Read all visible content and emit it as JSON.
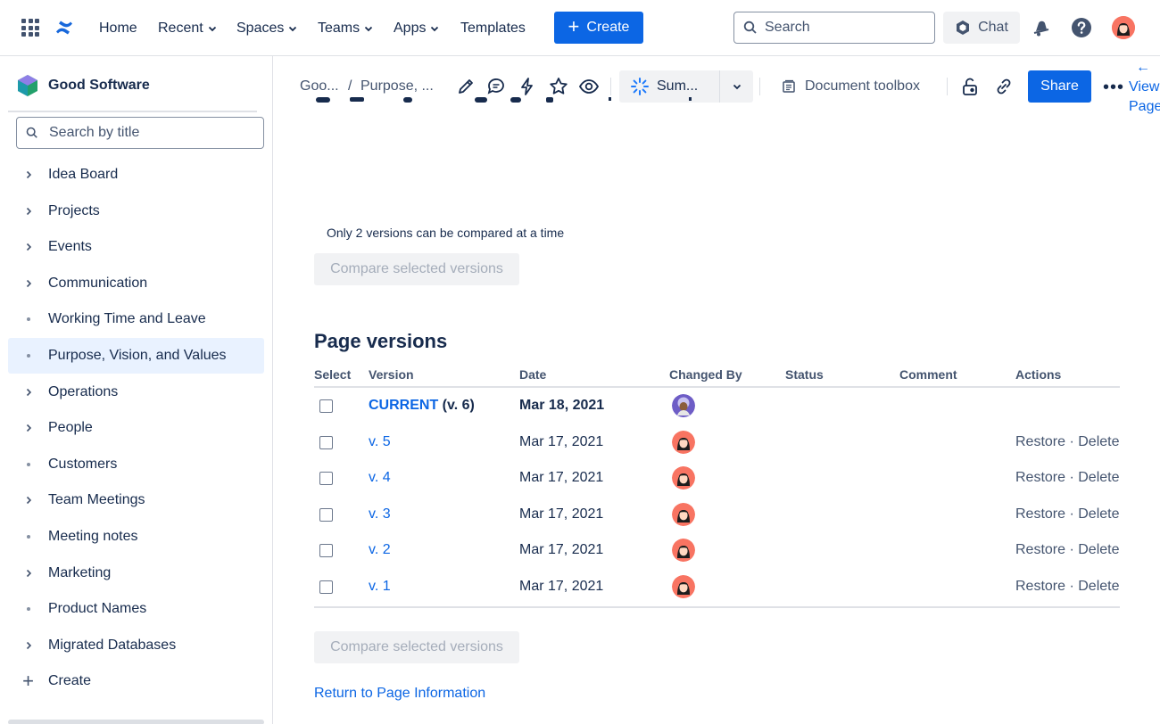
{
  "topnav": {
    "items": [
      {
        "label": "Home",
        "dropdown": false
      },
      {
        "label": "Recent",
        "dropdown": true
      },
      {
        "label": "Spaces",
        "dropdown": true
      },
      {
        "label": "Teams",
        "dropdown": true
      },
      {
        "label": "Apps",
        "dropdown": true
      },
      {
        "label": "Templates",
        "dropdown": false
      }
    ],
    "create_label": "Create",
    "search_placeholder": "Search",
    "chat_label": "Chat"
  },
  "sidebar": {
    "space_name": "Good Software",
    "search_placeholder": "Search by title",
    "items": [
      {
        "label": "Idea Board",
        "type": "chevron"
      },
      {
        "label": "Projects",
        "type": "chevron"
      },
      {
        "label": "Events",
        "type": "chevron"
      },
      {
        "label": "Communication",
        "type": "chevron"
      },
      {
        "label": "Working Time and Leave",
        "type": "dot"
      },
      {
        "label": "Purpose, Vision, and Values",
        "type": "dot",
        "active": true
      },
      {
        "label": "Operations",
        "type": "chevron"
      },
      {
        "label": "People",
        "type": "chevron"
      },
      {
        "label": "Customers",
        "type": "dot"
      },
      {
        "label": "Team Meetings",
        "type": "chevron"
      },
      {
        "label": "Meeting notes",
        "type": "dot"
      },
      {
        "label": "Marketing",
        "type": "chevron"
      },
      {
        "label": "Product Names",
        "type": "dot"
      },
      {
        "label": "Migrated Databases",
        "type": "chevron"
      }
    ],
    "create_label": "Create"
  },
  "toolbar": {
    "breadcrumb_1": "Goo...",
    "breadcrumb_sep": "/",
    "breadcrumb_2": "Purpose, ...",
    "summarize_label": "Sum...",
    "document_toolbox_label": "Document toolbox",
    "share_label": "Share",
    "view_page_arrow": "←",
    "view_page_label": "View Page"
  },
  "content": {
    "notice": "Only 2 versions can be compared at a time",
    "compare_label": "Compare selected versions",
    "section_title": "Page versions",
    "columns": [
      "Select",
      "Version",
      "Date",
      "Changed By",
      "Status",
      "Comment",
      "Actions"
    ],
    "rows": [
      {
        "version_link": "CURRENT",
        "version_suffix": "(v. 6)",
        "date": "Mar 18, 2021",
        "actions": "",
        "current": true
      },
      {
        "version_link": "v. 5",
        "version_suffix": "",
        "date": "Mar 17, 2021",
        "actions": "Restore · Delete"
      },
      {
        "version_link": "v. 4",
        "version_suffix": "",
        "date": "Mar 17, 2021",
        "actions": "Restore · Delete"
      },
      {
        "version_link": "v. 3",
        "version_suffix": "",
        "date": "Mar 17, 2021",
        "actions": "Restore · Delete"
      },
      {
        "version_link": "v. 2",
        "version_suffix": "",
        "date": "Mar 17, 2021",
        "actions": "Restore · Delete"
      },
      {
        "version_link": "v. 1",
        "version_suffix": "",
        "date": "Mar 17, 2021",
        "actions": "Restore · Delete"
      }
    ],
    "return_link": "Return to Page Information"
  },
  "colors": {
    "brand": "#0c66e4",
    "text": "#172b4d",
    "subtle": "#44546f",
    "active_bg": "#e9f2ff",
    "disabled_bg": "#f1f2f4",
    "disabled_text": "#a5adba"
  },
  "icons": {
    "topnav": [
      "app-grid-icon",
      "confluence-logo-icon",
      "plus-icon",
      "search-icon",
      "chat-icon",
      "notification-icon",
      "help-icon"
    ],
    "toolbar": [
      "edit-icon",
      "comment-icon",
      "automation-icon",
      "star-icon",
      "watch-icon",
      "summarize-icon",
      "chevron-down-icon",
      "document-toolbox-icon",
      "restrictions-icon",
      "link-icon",
      "more-icon",
      "arrow-left-icon"
    ]
  }
}
